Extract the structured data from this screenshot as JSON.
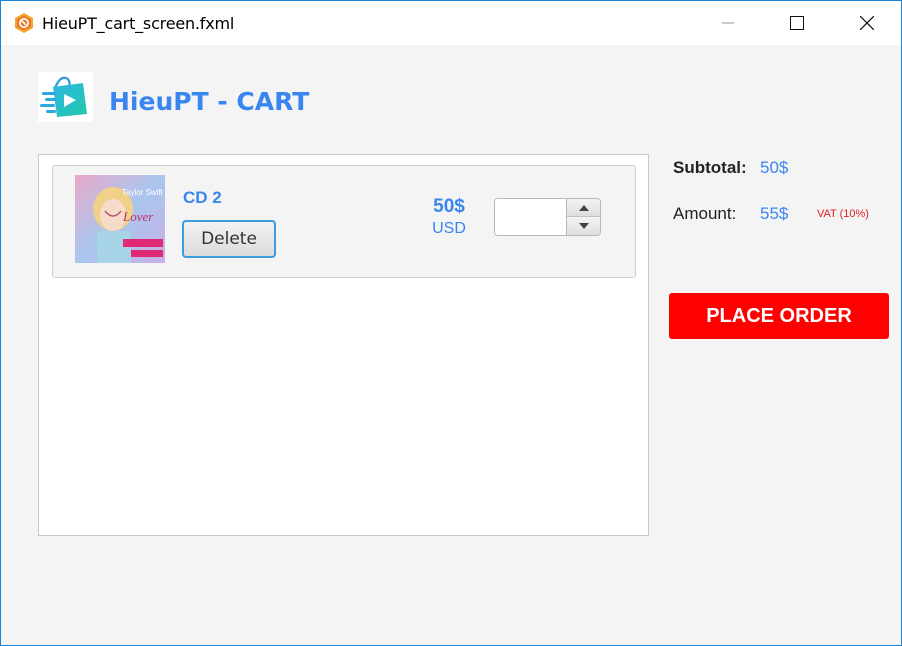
{
  "window": {
    "title": "HieuPT_cart_screen.fxml"
  },
  "header": {
    "brand_title": "HieuPT - CART",
    "logo_icon": "shopping-bag-icon"
  },
  "cart": {
    "items": [
      {
        "name": "CD 2",
        "cover_icon": "album-cover-image",
        "cover_text": [
          "Taylor Swift",
          "Lover"
        ],
        "delete_label": "Delete",
        "price": "50$",
        "currency": "USD",
        "quantity_value": ""
      }
    ]
  },
  "summary": {
    "subtotal_label": "Subtotal:",
    "subtotal_value": "50$",
    "amount_label": "Amount:",
    "amount_value": "55$",
    "vat_note": "VAT (10%)"
  },
  "actions": {
    "place_order_label": "PLACE ORDER"
  },
  "colors": {
    "accent": "#3a86f0",
    "order_button": "#ff0000",
    "vat_text": "#e02020",
    "window_border": "#1883d7"
  }
}
